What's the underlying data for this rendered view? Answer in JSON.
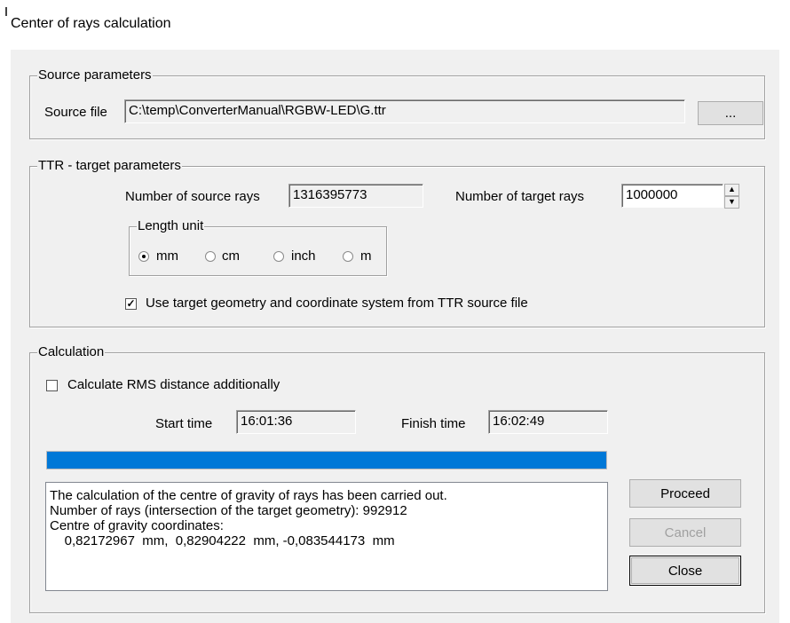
{
  "window": {
    "title": "Center of rays calculation"
  },
  "source": {
    "group_label": "Source parameters",
    "file_label": "Source file",
    "file_value": "C:\\temp\\ConverterManual\\RGBW-LED\\G.ttr",
    "browse_label": "..."
  },
  "target": {
    "group_label": "TTR - target parameters",
    "source_rays_label": "Number of source rays",
    "source_rays_value": "1316395773",
    "target_rays_label": "Number of target rays",
    "target_rays_value": "1000000",
    "spin_up": "▲",
    "spin_down": "▼",
    "length_unit": {
      "group_label": "Length unit",
      "options": [
        {
          "label": "mm",
          "selected": true
        },
        {
          "label": "cm",
          "selected": false
        },
        {
          "label": "inch",
          "selected": false
        },
        {
          "label": "m",
          "selected": false
        }
      ]
    },
    "use_target_geometry_label": "Use target geometry and coordinate system from TTR source file",
    "use_target_geometry_checked": true,
    "check_mark": "✓"
  },
  "calculation": {
    "group_label": "Calculation",
    "rms_label": "Calculate RMS distance additionally",
    "rms_checked": false,
    "start_label": "Start time",
    "start_value": "16:01:36",
    "finish_label": "Finish time",
    "finish_value": "16:02:49",
    "progress": 1.0,
    "results": [
      "The calculation of the centre of gravity of rays has been carried out.",
      "Number of rays (intersection of the target geometry): 992912",
      "Centre of gravity coordinates:",
      "    0,82172967  mm,  0,82904222  mm, -0,083544173  mm"
    ]
  },
  "buttons": {
    "proceed": "Proceed",
    "cancel": "Cancel",
    "close": "Close"
  },
  "colors": {
    "progress_fill": "#0078d7",
    "dialog_bg": "#f0f0f0"
  }
}
